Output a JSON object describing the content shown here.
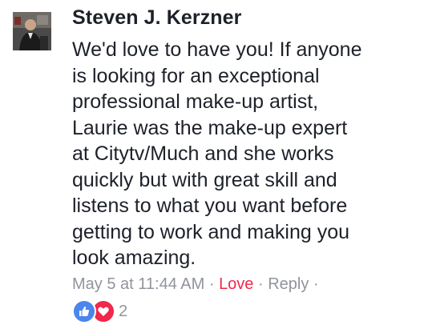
{
  "comment": {
    "author": "Steven J. Kerzner",
    "text": "We'd love to have you! If anyone\nis looking for an exceptional\nprofessional make-up artist,\nLaurie was the make-up expert\nat Citytv/Much and she works\nquickly but with great skill and\nlistens to what you want before\ngetting to work and making you\nlook amazing.",
    "timestamp": "May 5 at 11:44 AM",
    "separator": " · ",
    "reaction_label": "Love",
    "reply_label": "Reply",
    "reaction_icons": [
      "like-icon",
      "love-icon"
    ],
    "reaction_count": "2"
  },
  "colors": {
    "love_accent": "#f0284a",
    "like_accent": "#4a86ee",
    "meta_text": "#90949c",
    "body_text": "#1d2129"
  }
}
